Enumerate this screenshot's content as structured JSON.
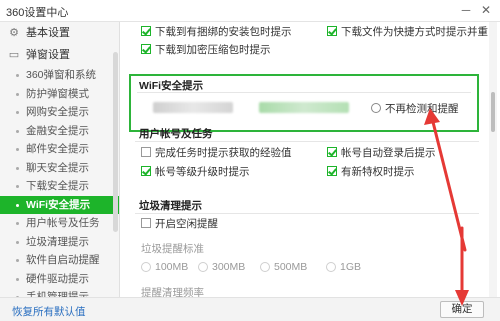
{
  "window": {
    "title": "360设置中心",
    "minimize_glyph": "─",
    "close_glyph": "✕"
  },
  "sidebar": {
    "categories": [
      {
        "label": "基本设置",
        "icon": "gear-icon",
        "icon_glyph": "⚙"
      },
      {
        "label": "弹窗设置",
        "icon": "window-icon",
        "icon_glyph": "▭"
      }
    ],
    "items": [
      {
        "label": "360弹窗和系统",
        "active": false
      },
      {
        "label": "防护弹窗模式",
        "active": false
      },
      {
        "label": "网购安全提示",
        "active": false
      },
      {
        "label": "金融安全提示",
        "active": false
      },
      {
        "label": "邮件安全提示",
        "active": false
      },
      {
        "label": "聊天安全提示",
        "active": false
      },
      {
        "label": "下载安全提示",
        "active": false
      },
      {
        "label": "WiFi安全提示",
        "active": true
      },
      {
        "label": "用户帐号及任务",
        "active": false
      },
      {
        "label": "垃圾清理提示",
        "active": false
      },
      {
        "label": "软件自启动提醒",
        "active": false
      },
      {
        "label": "硬件驱动提示",
        "active": false
      },
      {
        "label": "手机管理提示",
        "active": false
      }
    ]
  },
  "download_section": {
    "opt1": {
      "label": "下载到有捆绑的安装包时提示",
      "checked": true
    },
    "opt2": {
      "label": "下载文件为快捷方式时提示并重命名",
      "checked": true
    },
    "opt3": {
      "label": "下载到加密压缩包时提示",
      "checked": true
    }
  },
  "wifi_section": {
    "title": "WiFi安全提示",
    "radio_label": "不再检测和提醒"
  },
  "account_section": {
    "title": "用户帐号及任务",
    "opt1": {
      "label": "完成任务时提示获取的经验值",
      "checked": false
    },
    "opt2": {
      "label": "帐号自动登录后提示",
      "checked": true
    },
    "opt3": {
      "label": "帐号等级升级时提示",
      "checked": true
    },
    "opt4": {
      "label": "有新特权时提示",
      "checked": true
    }
  },
  "junk_section": {
    "title": "垃圾清理提示",
    "opt1": {
      "label": "开启空闲提醒",
      "checked": false
    },
    "threshold_label": "垃圾提醒标准",
    "sizes": [
      "100MB",
      "300MB",
      "500MB",
      "1GB"
    ],
    "selected_size": "100MB",
    "next_label": "提醒清理频率"
  },
  "footer": {
    "restore_label": "恢复所有默认值",
    "ok_label": "确定"
  },
  "colors": {
    "accent": "#1db42a",
    "annotation_arrow": "#e53935"
  }
}
